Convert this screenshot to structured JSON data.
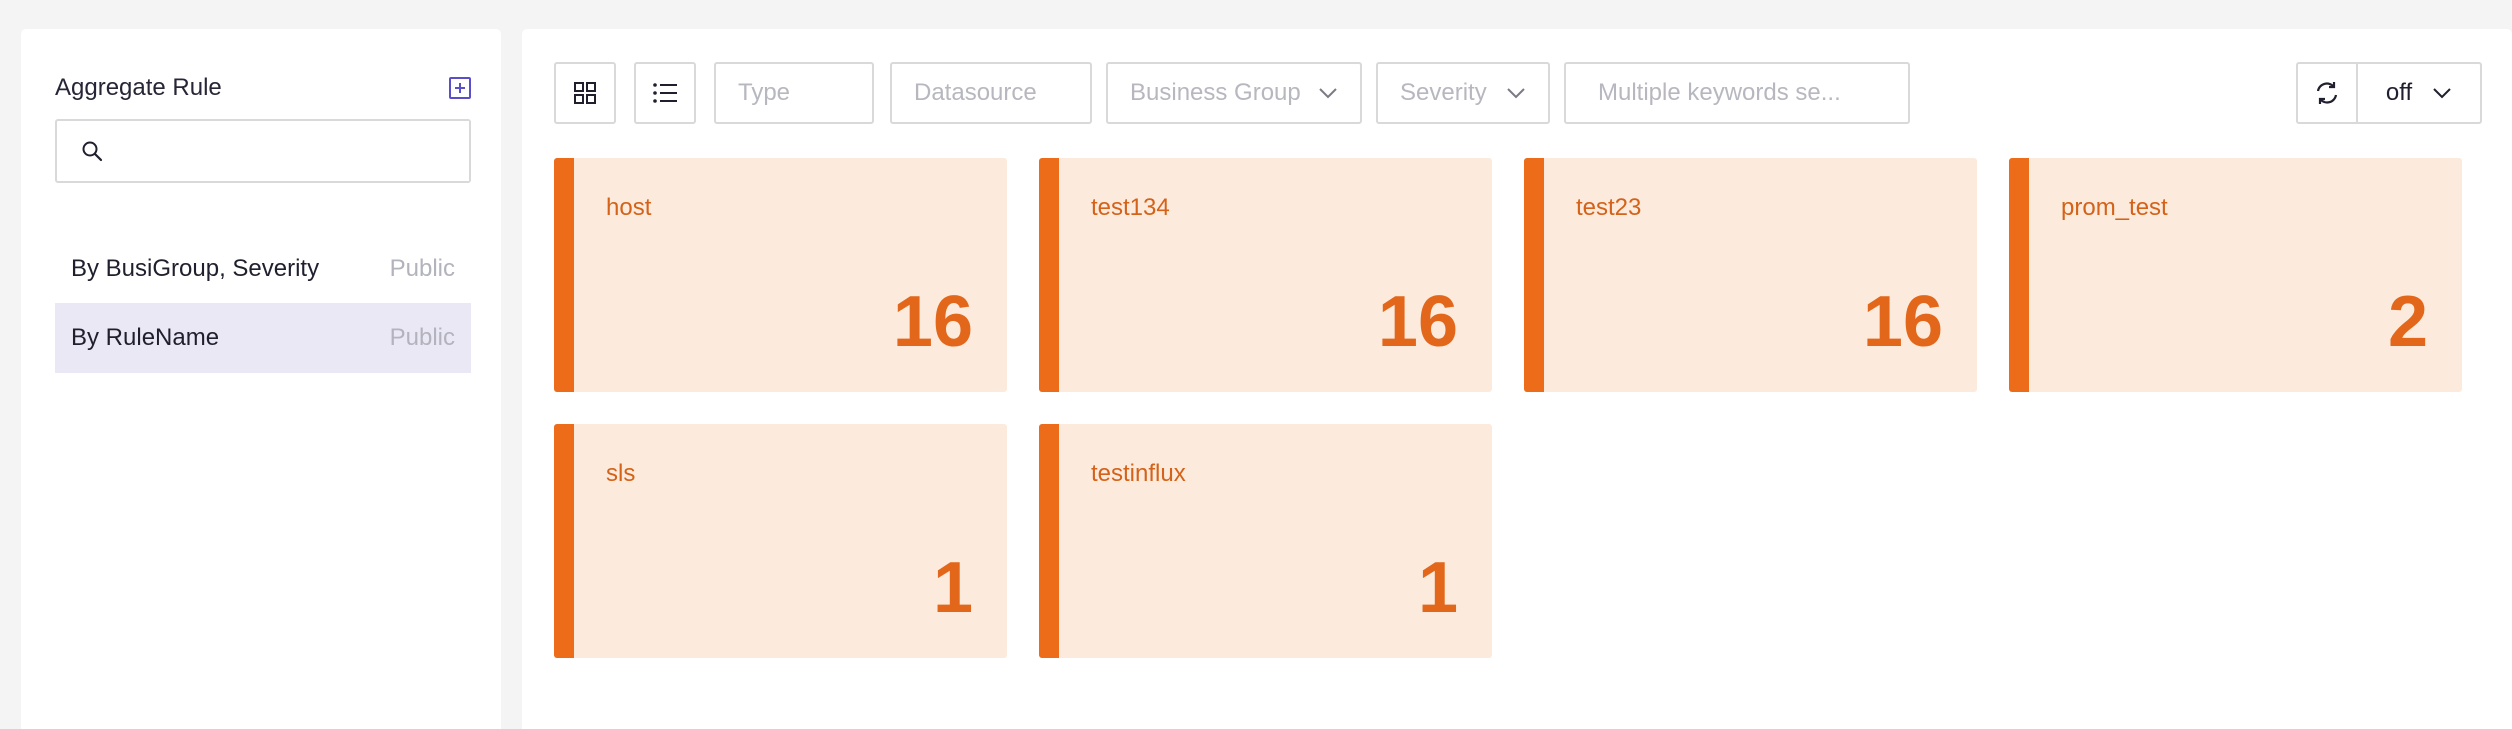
{
  "sidebar": {
    "title": "Aggregate Rule",
    "search_placeholder": "",
    "items": [
      {
        "label": "By BusiGroup, Severity",
        "visibility": "Public",
        "active": false
      },
      {
        "label": "By RuleName",
        "visibility": "Public",
        "active": true
      }
    ]
  },
  "toolbar": {
    "view_modes": [
      "grid-view-icon",
      "list-view-icon"
    ],
    "type_placeholder": "Type",
    "datasource_placeholder": "Datasource",
    "business_group_placeholder": "Business Group",
    "severity_placeholder": "Severity",
    "search_placeholder": "Multiple keywords se...",
    "refresh_interval": "off"
  },
  "cards": [
    {
      "title": "host",
      "count": "16"
    },
    {
      "title": "test134",
      "count": "16"
    },
    {
      "title": "test23",
      "count": "16"
    },
    {
      "title": "prom_test",
      "count": "2"
    },
    {
      "title": "sls",
      "count": "1"
    },
    {
      "title": "testinflux",
      "count": "1"
    }
  ],
  "colors": {
    "accent": "#ed6c1a",
    "card_bg": "#fcebdd",
    "active_item_bg": "#ebe8f5",
    "add_icon": "#5b4fc9"
  }
}
